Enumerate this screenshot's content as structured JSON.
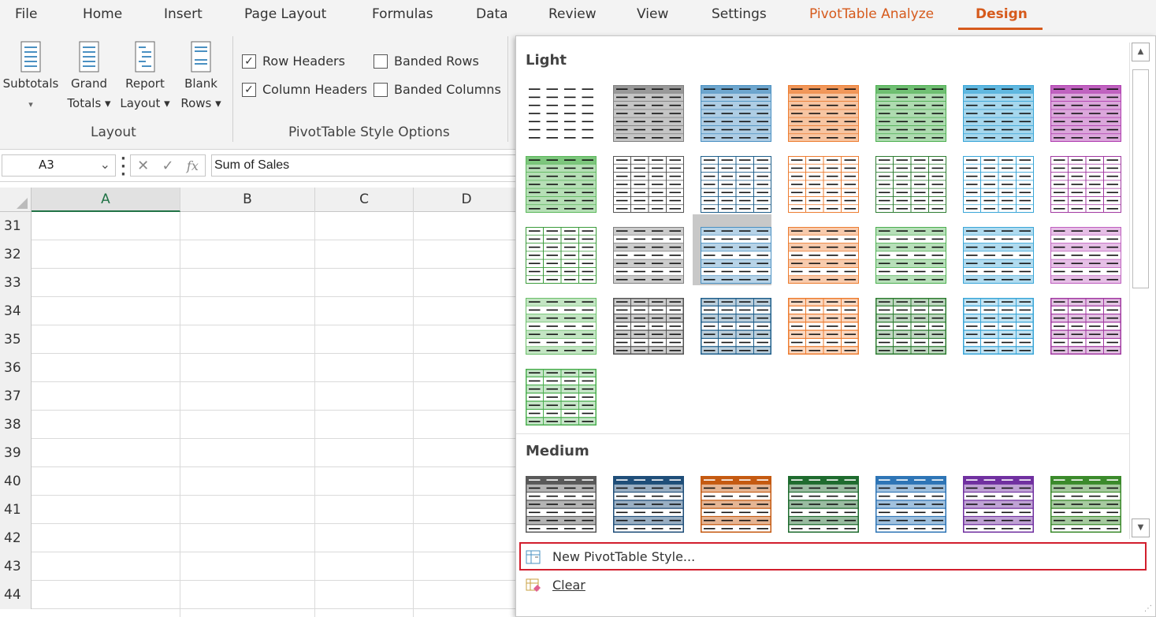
{
  "ribbon": {
    "tabs": [
      {
        "label": "File"
      },
      {
        "label": "Home"
      },
      {
        "label": "Insert"
      },
      {
        "label": "Page Layout"
      },
      {
        "label": "Formulas"
      },
      {
        "label": "Data"
      },
      {
        "label": "Review"
      },
      {
        "label": "View"
      },
      {
        "label": "Settings"
      },
      {
        "label": "PivotTable Analyze"
      },
      {
        "label": "Design"
      }
    ],
    "active_tab": "Design",
    "accent_color": "#d65a1c",
    "layout_group": {
      "label": "Layout",
      "buttons": [
        {
          "line1": "Subtotals",
          "line2": "▾",
          "icon": "subtotals-icon"
        },
        {
          "line1": "Grand",
          "line2": "Totals ▾",
          "icon": "grand-totals-icon"
        },
        {
          "line1": "Report",
          "line2": "Layout ▾",
          "icon": "report-layout-icon"
        },
        {
          "line1": "Blank",
          "line2": "Rows ▾",
          "icon": "blank-rows-icon"
        }
      ]
    },
    "style_options_group": {
      "label": "PivotTable Style Options",
      "options": [
        {
          "label": "Row Headers",
          "checked": true
        },
        {
          "label": "Column Headers",
          "checked": true
        },
        {
          "label": "Banded Rows",
          "checked": false
        },
        {
          "label": "Banded Columns",
          "checked": false
        }
      ]
    }
  },
  "formula_bar": {
    "name_box": "A3",
    "fx_symbol": "fx",
    "content": "Sum of Sales"
  },
  "sheet": {
    "columns": [
      "A",
      "B",
      "C",
      "D"
    ],
    "selected_column": "A",
    "rows": [
      "31",
      "32",
      "33",
      "34",
      "35",
      "36",
      "37",
      "38",
      "39",
      "40",
      "41",
      "42",
      "43",
      "44"
    ]
  },
  "gallery": {
    "sections": [
      {
        "label": "Light"
      },
      {
        "label": "Medium"
      }
    ],
    "light_styles": [
      {
        "color": "#333333",
        "style": "plain"
      },
      {
        "color": "#7f7f7f",
        "style": "filled"
      },
      {
        "color": "#4a90c2",
        "style": "filled"
      },
      {
        "color": "#ed7d31",
        "style": "filled"
      },
      {
        "color": "#4caf50",
        "style": "filled"
      },
      {
        "color": "#3aa6d8",
        "style": "filled"
      },
      {
        "color": "#b03cb0",
        "style": "filled"
      },
      {
        "color": "#5cb85c",
        "style": "filled"
      },
      {
        "color": "#555555",
        "style": "grid"
      },
      {
        "color": "#1f5f8b",
        "style": "grid"
      },
      {
        "color": "#ed7d31",
        "style": "grid"
      },
      {
        "color": "#2e7d32",
        "style": "grid"
      },
      {
        "color": "#3aa6d8",
        "style": "grid"
      },
      {
        "color": "#a23aa2",
        "style": "grid"
      },
      {
        "color": "#3b9b3b",
        "style": "outline"
      },
      {
        "color": "#7f7f7f",
        "style": "banded"
      },
      {
        "color": "#4a90c2",
        "style": "banded",
        "selected": true
      },
      {
        "color": "#ed7d31",
        "style": "banded"
      },
      {
        "color": "#4caf50",
        "style": "banded"
      },
      {
        "color": "#3aa6d8",
        "style": "banded"
      },
      {
        "color": "#c060c0",
        "style": "banded"
      },
      {
        "color": "#6abf69",
        "style": "banded"
      },
      {
        "color": "#555555",
        "style": "bold"
      },
      {
        "color": "#1f5f8b",
        "style": "bold"
      },
      {
        "color": "#ed7d31",
        "style": "bold"
      },
      {
        "color": "#2e7d32",
        "style": "bold"
      },
      {
        "color": "#3aa6d8",
        "style": "bold"
      },
      {
        "color": "#a23aa2",
        "style": "bold"
      },
      {
        "color": "#4caf50",
        "style": "bold"
      }
    ],
    "medium_styles": [
      {
        "color": "#595959"
      },
      {
        "color": "#1f4e79"
      },
      {
        "color": "#c55a11"
      },
      {
        "color": "#1e6b2e"
      },
      {
        "color": "#2e75b6"
      },
      {
        "color": "#7030a0"
      },
      {
        "color": "#3b8a2b"
      }
    ],
    "footer": {
      "new_style": "New PivotTable Style...",
      "clear": "Clear"
    }
  }
}
